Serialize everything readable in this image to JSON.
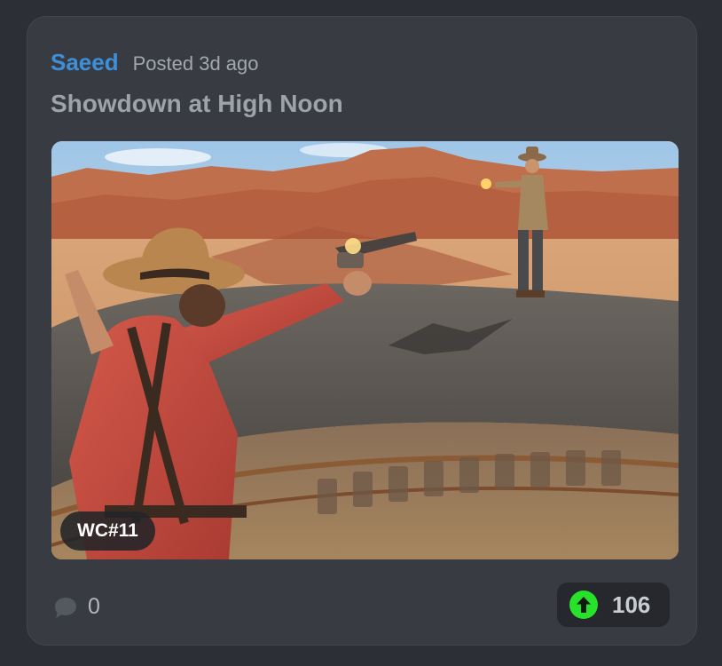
{
  "post": {
    "author": "Saeed",
    "posted": "Posted 3d ago",
    "title": "Showdown at High Noon",
    "image_alt": "Cowboy standoff on top of a moving train in the desert",
    "badge": "WC#11"
  },
  "footer": {
    "comment_icon": "speech-bubble-icon",
    "comment_count": "0",
    "upvote_icon": "arrow-up-circle-icon",
    "upvote_count": "106"
  },
  "colors": {
    "page_background": "#2c2f35",
    "card_background": "#383b42",
    "author": "#3d8fd8",
    "upvote_accent": "#27e12a"
  }
}
